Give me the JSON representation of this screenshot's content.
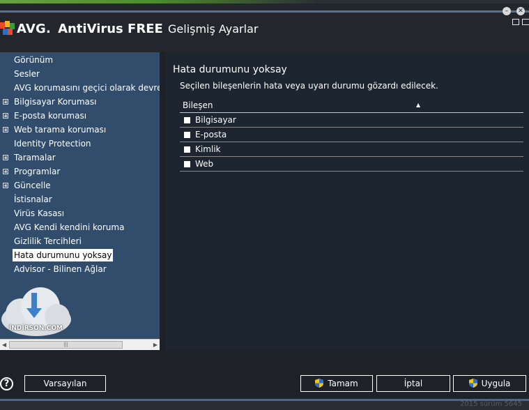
{
  "app": {
    "brand": "AVG.",
    "product": "AntiVirus FREE",
    "section_title": "Gelişmiş Ayarlar",
    "colors": {
      "sidebar": "#324d6b",
      "content": "#1c2530",
      "chrome": "#23262c",
      "accent_green": "#6aa040"
    }
  },
  "window_buttons": [
    "minimize",
    "close"
  ],
  "sidebar": {
    "items": [
      {
        "label": "Görünüm",
        "expandable": false,
        "selected": false
      },
      {
        "label": "Sesler",
        "expandable": false,
        "selected": false
      },
      {
        "label": "AVG korumasını geçici olarak devre dı",
        "expandable": false,
        "selected": false
      },
      {
        "label": "Bilgisayar Koruması",
        "expandable": true,
        "selected": false
      },
      {
        "label": "E-posta koruması",
        "expandable": true,
        "selected": false
      },
      {
        "label": "Web tarama koruması",
        "expandable": true,
        "selected": false
      },
      {
        "label": "Identity Protection",
        "expandable": false,
        "selected": false
      },
      {
        "label": "Taramalar",
        "expandable": true,
        "selected": false
      },
      {
        "label": "Programlar",
        "expandable": true,
        "selected": false
      },
      {
        "label": "Güncelle",
        "expandable": true,
        "selected": false
      },
      {
        "label": "İstisnalar",
        "expandable": false,
        "selected": false
      },
      {
        "label": "Virüs Kasası",
        "expandable": false,
        "selected": false
      },
      {
        "label": "AVG Kendi kendini koruma",
        "expandable": false,
        "selected": false
      },
      {
        "label": "Gizlilik Tercihleri",
        "expandable": false,
        "selected": false
      },
      {
        "label": "Hata durumunu yoksay",
        "expandable": false,
        "selected": true
      },
      {
        "label": "Advisor - Bilinen Ağlar",
        "expandable": false,
        "selected": false
      }
    ],
    "watermark": "İNDİRSON.COM"
  },
  "main": {
    "heading": "Hata durumunu yoksay",
    "description": "Seçilen bileşenlerin hata veya uyarı durumu gözardı edilecek.",
    "table": {
      "column_header": "Bileşen",
      "sort_indicator": "▲",
      "rows": [
        {
          "label": "Bilgisayar",
          "checked": false
        },
        {
          "label": "E-posta",
          "checked": false
        },
        {
          "label": "Kimlik",
          "checked": false
        },
        {
          "label": "Web",
          "checked": false
        }
      ]
    }
  },
  "buttons": {
    "help": "?",
    "defaults": "Varsayılan",
    "ok": "Tamam",
    "cancel": "İptal",
    "apply": "Uygula"
  },
  "footer": {
    "version": "2015  sürüm 5645"
  }
}
